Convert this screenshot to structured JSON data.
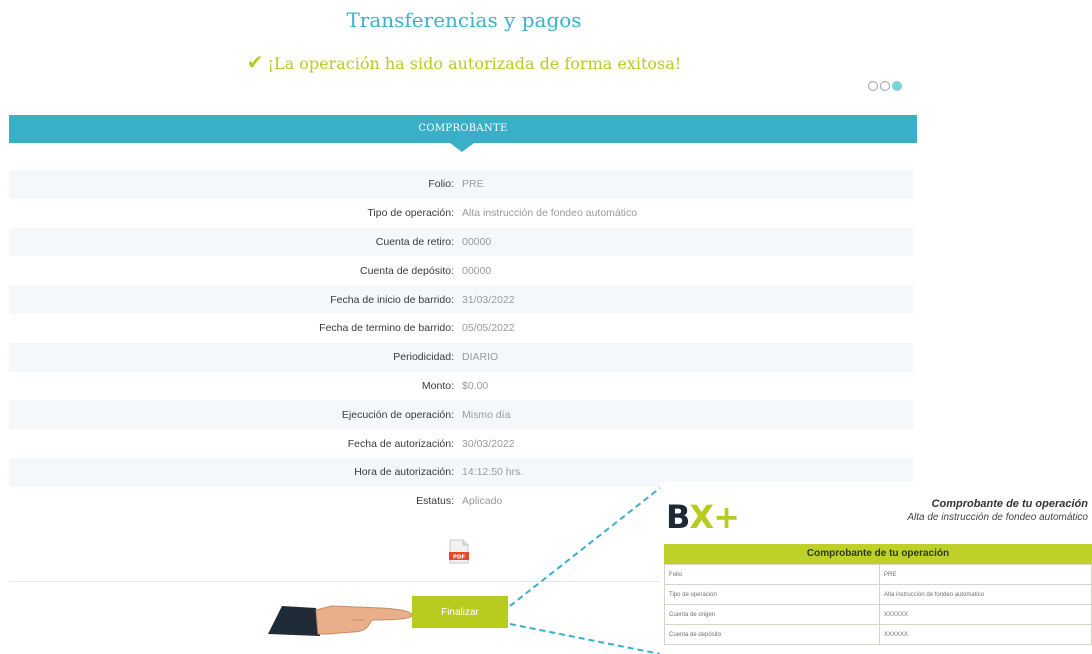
{
  "header": {
    "title": "Transferencias y pagos",
    "success_message": "¡La operación ha sido autorizada de forma exitosa!",
    "success_icon": "check-icon",
    "steps": [
      {
        "active": false
      },
      {
        "active": false
      },
      {
        "active": true
      }
    ]
  },
  "receipt": {
    "band_title": "COMPROBANTE",
    "rows": [
      {
        "label": "Folio:",
        "value": "PRE"
      },
      {
        "label": "Tipo de operación:",
        "value": "Alta instrucción de fondeo automático"
      },
      {
        "label": "Cuenta de retiro:",
        "value": "00000"
      },
      {
        "label": "Cuenta de depósito:",
        "value": "00000"
      },
      {
        "label": "Fecha de inicio de barrido:",
        "value": "31/03/2022"
      },
      {
        "label": "Fecha de termino de barrido:",
        "value": "05/05/2022"
      },
      {
        "label": "Periodicidad:",
        "value": "DIARIO"
      },
      {
        "label": "Monto:",
        "value": "$0.00"
      },
      {
        "label": "Ejecución de operación:",
        "value": "Mismo día"
      },
      {
        "label": "Fecha de autorización:",
        "value": "30/03/2022"
      },
      {
        "label": "Hora de autorización:",
        "value": "14:12:50 hrs."
      },
      {
        "label": "Estatus:",
        "value": "Aplicado"
      }
    ],
    "pdf_icon": "pdf-icon",
    "pdf_label": "PDF"
  },
  "actions": {
    "finish_label": "Finalizar"
  },
  "preview": {
    "logo_b": "B",
    "logo_x": "X+",
    "title": "Comprobante de tu operación",
    "subtitle": "Alta de instrucción de fondeo automático",
    "table_header": "Comprobante de tu operación",
    "rows": [
      {
        "label": "Folio",
        "value": "PRE"
      },
      {
        "label": "Tipo de operacion",
        "value": "Alta instrucción de fondeo automatico"
      },
      {
        "label": "Cuenta de origen",
        "value": "XXXXXX"
      },
      {
        "label": "Cuenta de depósito",
        "value": "XXXXXX"
      }
    ]
  },
  "colors": {
    "accent": "#3ab0c8",
    "success": "#b7cc1f",
    "button": "#b8cc1f"
  }
}
